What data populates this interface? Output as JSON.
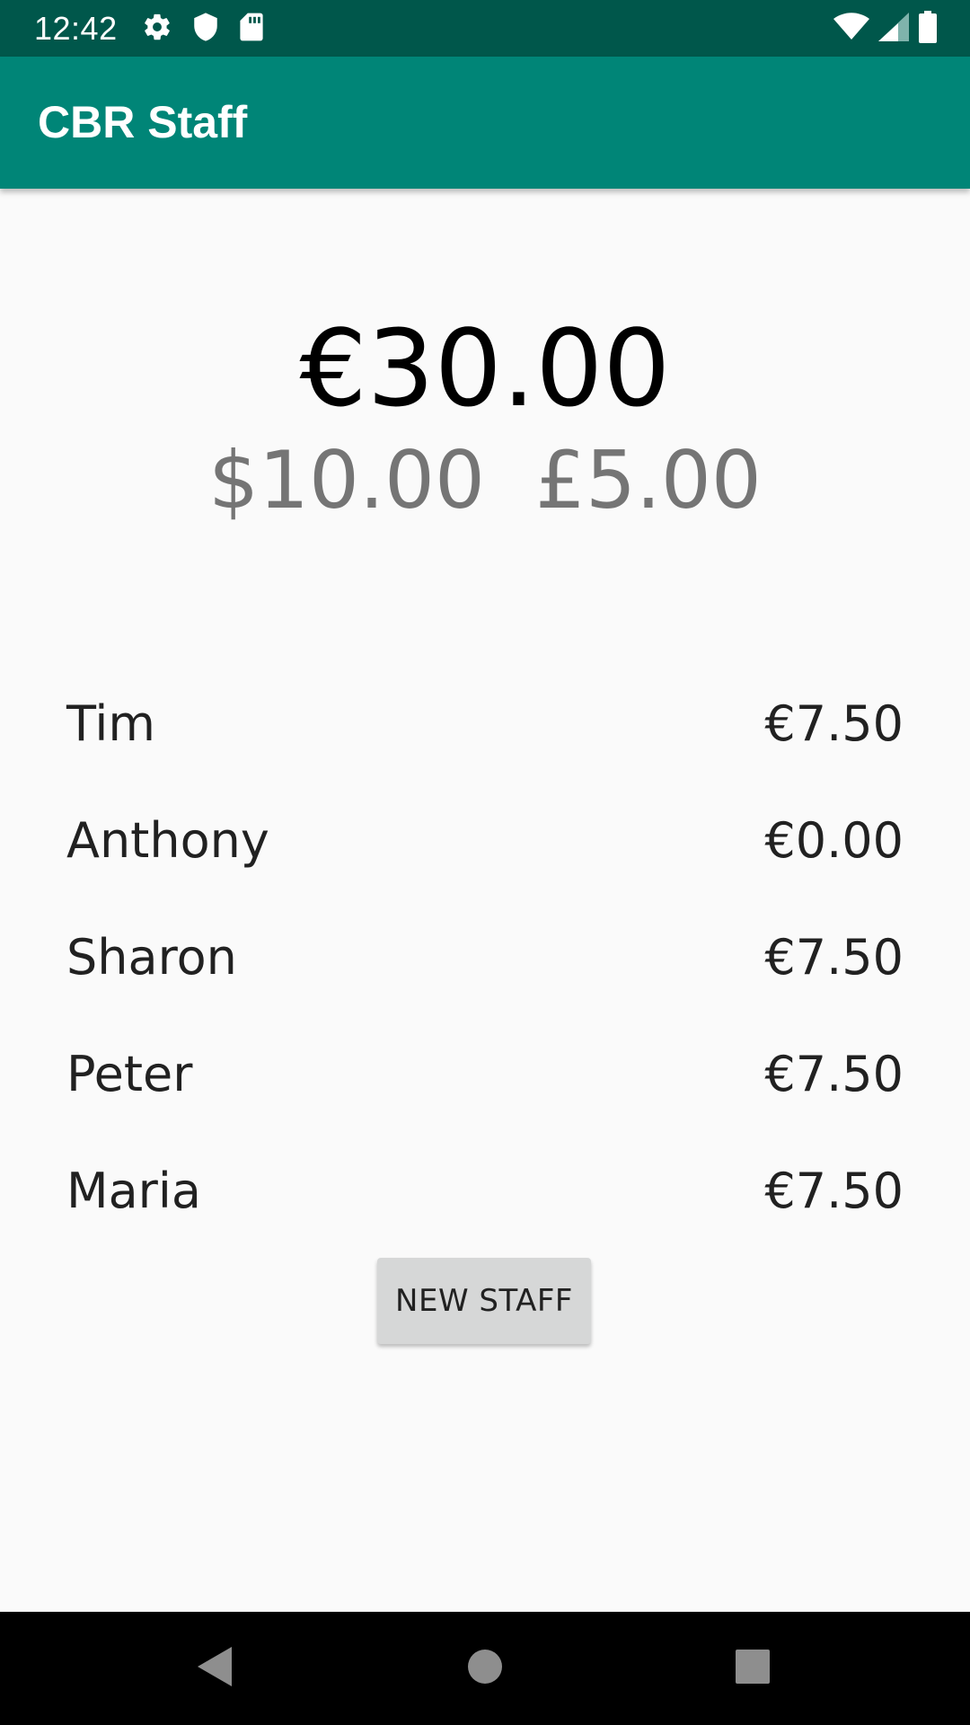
{
  "status_bar": {
    "time": "12:42",
    "left_icons": [
      "settings-icon",
      "shield-icon",
      "sd-card-icon"
    ],
    "right_icons": [
      "wifi-icon",
      "cell-signal-icon",
      "battery-icon"
    ]
  },
  "app_bar": {
    "title": "CBR Staff"
  },
  "totals": {
    "main": "€30.00",
    "secondary": [
      "$10.00",
      "£5.00"
    ]
  },
  "staff": [
    {
      "name": "Tim",
      "amount": "€7.50"
    },
    {
      "name": "Anthony",
      "amount": "€0.00"
    },
    {
      "name": "Sharon",
      "amount": "€7.50"
    },
    {
      "name": "Peter",
      "amount": "€7.50"
    },
    {
      "name": "Maria",
      "amount": "€7.50"
    }
  ],
  "button": {
    "new_staff_label": "NEW STAFF"
  },
  "nav_bar": {
    "icons": [
      "back-icon",
      "home-icon",
      "recents-icon"
    ]
  },
  "colors": {
    "status_bar": "#00574b",
    "app_bar": "#008577",
    "background": "#fafafa",
    "secondary_text": "#757575",
    "button": "#d6d7d7"
  }
}
